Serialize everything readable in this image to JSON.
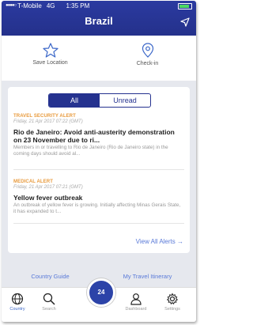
{
  "status_bar": {
    "carrier": "T-Mobile",
    "network": "4G",
    "time": "1:35 PM"
  },
  "header": {
    "title": "Brazil"
  },
  "actions": {
    "save_location": "Save Location",
    "check_in": "Check-in"
  },
  "alerts_card": {
    "tabs": {
      "all": "All",
      "unread": "Unread"
    },
    "alerts": [
      {
        "type": "TRAVEL SECURITY ALERT",
        "date": "Friday, 21 Apr 2017 07:22 (GMT)",
        "headline": "Rio de Janeiro: Avoid anti-austerity demonstration on 23 November due to ri...",
        "body": "Members in or travelling to Rio de Janeiro (Rio de Janeiro state) in the coming days should avoid al..."
      },
      {
        "type": "MEDICAL ALERT",
        "date": "Friday, 21 Apr 2017 07:21 (GMT)",
        "headline": "Yellow fever outbreak",
        "body": "An outbreak of yellow fever is growing. Initially affecting Minas Gerais State, it has expanded to t..."
      }
    ],
    "view_all": "View All Alerts →"
  },
  "links": {
    "country_guide": "Country Guide",
    "itinerary": "My Travel Itinerary"
  },
  "tabbar": {
    "country": "Country",
    "search": "Search",
    "sos": "24",
    "dashboard": "Dashboard",
    "settings": "Settings"
  }
}
